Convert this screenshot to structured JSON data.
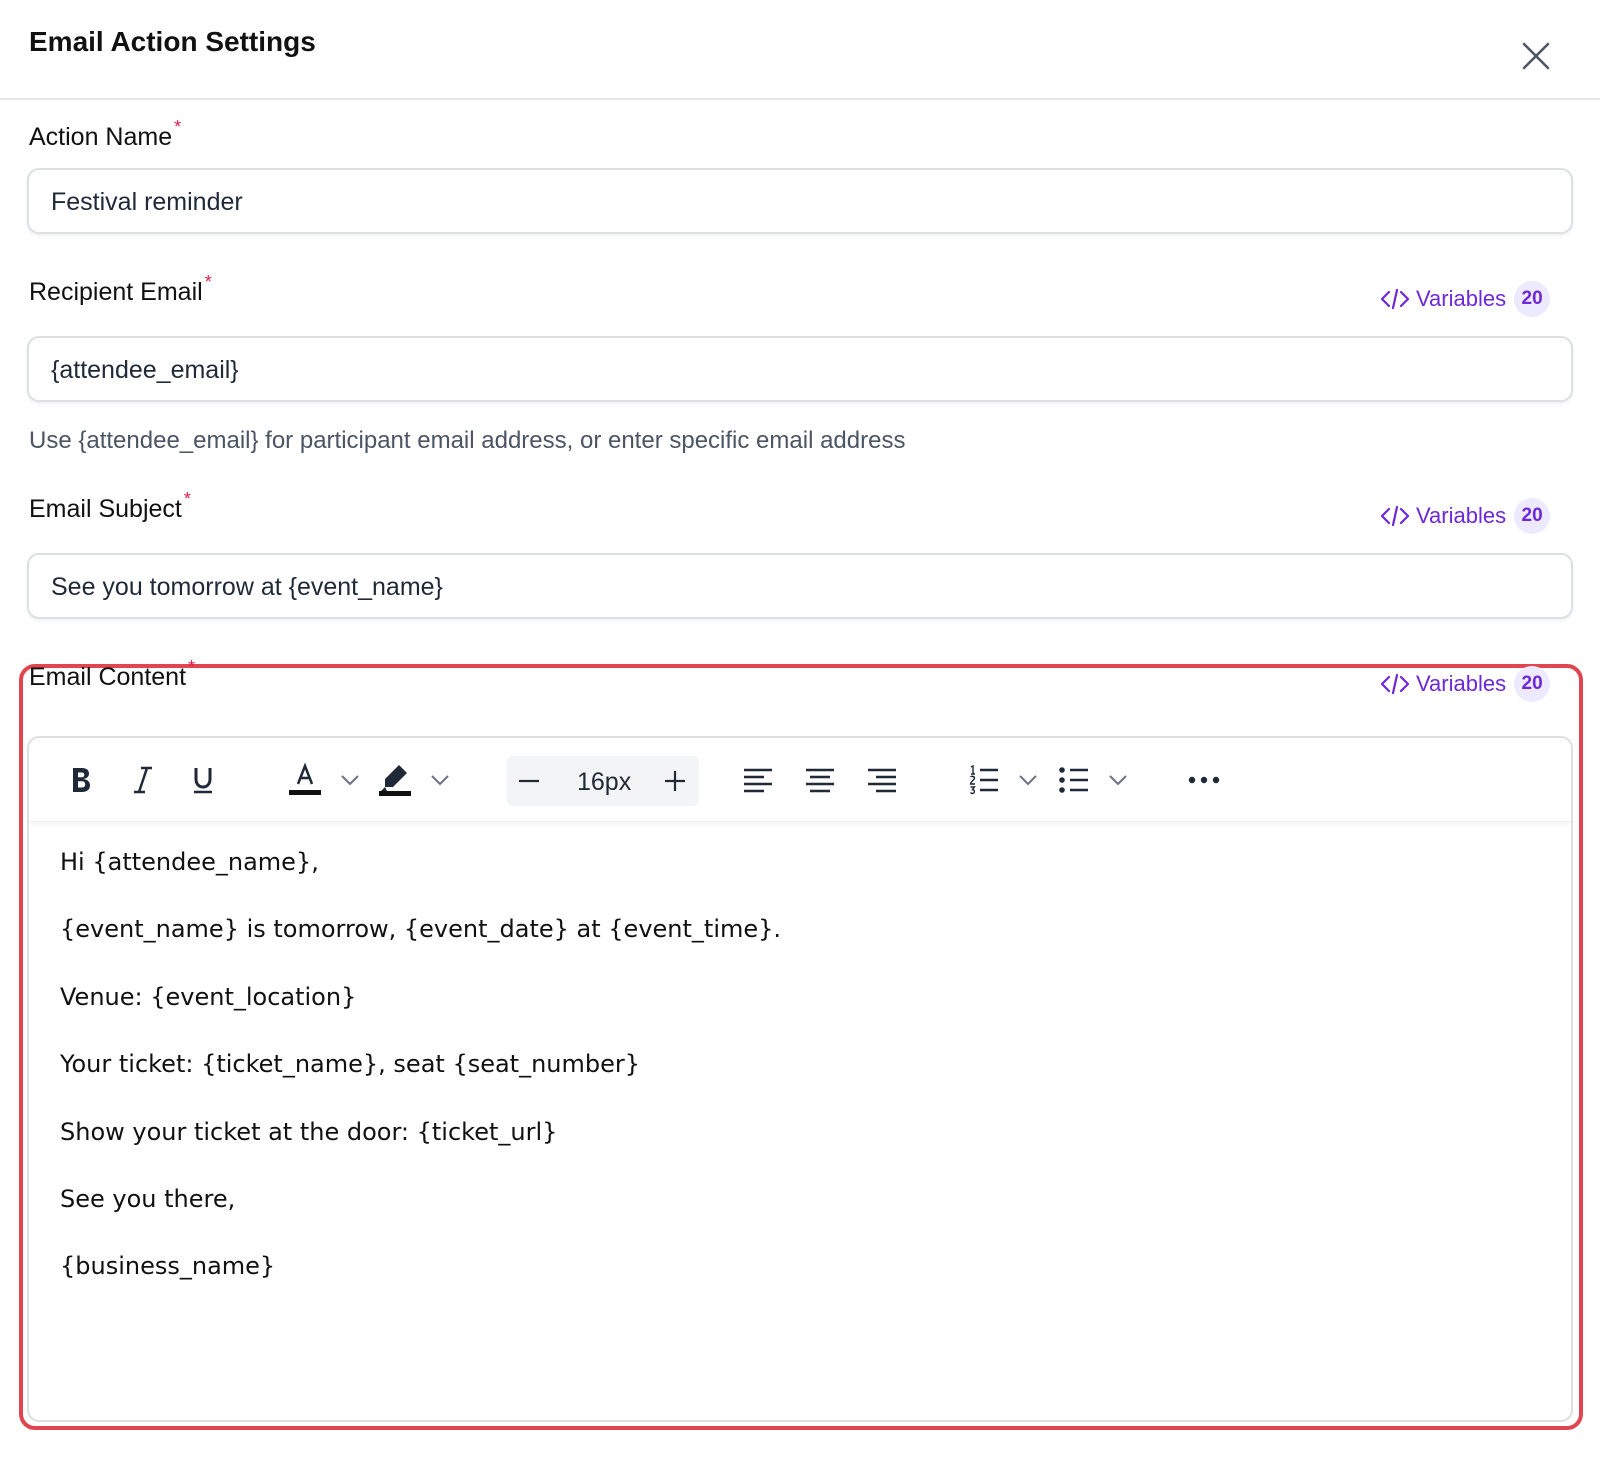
{
  "header": {
    "title": "Email Action Settings"
  },
  "fields": {
    "action_name": {
      "label": "Action Name",
      "required_mark": "*",
      "value": "Festival reminder"
    },
    "recipient_email": {
      "label": "Recipient Email",
      "required_mark": "*",
      "value": "{attendee_email}",
      "helper": "Use {attendee_email} for participant email address, or enter specific email address"
    },
    "email_subject": {
      "label": "Email Subject",
      "required_mark": "*",
      "value": "See you tomorrow at {event_name}"
    },
    "email_content": {
      "label": "Email Content",
      "required_mark": "*"
    }
  },
  "variables": {
    "label": "Variables",
    "count": "20"
  },
  "toolbar": {
    "font_size": "16px"
  },
  "content_lines": [
    "Hi {attendee_name},",
    "{event_name} is tomorrow, {event_date} at {event_time}.",
    "Venue: {event_location}",
    "Your ticket: {ticket_name}, seat {seat_number}",
    "Show your ticket at the door: {ticket_url}",
    "See you there,",
    "{business_name}"
  ],
  "colors": {
    "accent": "#6d28d9",
    "badge_bg": "#ede9fe",
    "required": "#e11d48",
    "highlight": "#e0464f"
  }
}
